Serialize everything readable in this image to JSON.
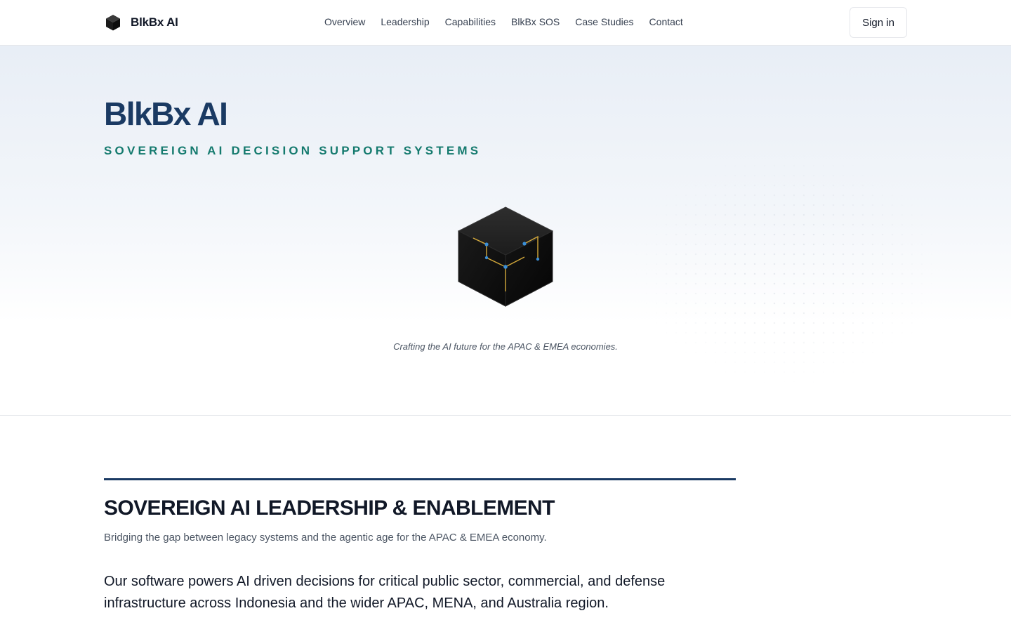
{
  "header": {
    "brand_name": "BlkBx AI",
    "nav": [
      {
        "label": "Overview"
      },
      {
        "label": "Leadership"
      },
      {
        "label": "Capabilities"
      },
      {
        "label": "BlkBx SOS"
      },
      {
        "label": "Case Studies"
      },
      {
        "label": "Contact"
      }
    ],
    "signin_label": "Sign in"
  },
  "hero": {
    "title": "BlkBx AI",
    "subtitle": "SOVEREIGN AI DECISION SUPPORT SYSTEMS",
    "cube_icon": "circuit-cube-icon",
    "tagline": "Crafting the AI future for the APAC & EMEA economies."
  },
  "section": {
    "heading": "SOVEREIGN AI LEADERSHIP & ENABLEMENT",
    "subheading": "Bridging the gap between legacy systems and the agentic age for the APAC & EMEA economy.",
    "body": "Our software powers AI driven decisions for critical public sector, commercial, and defense infrastructure across Indonesia and the wider APAC, MENA, and Australia region."
  },
  "colors": {
    "title_navy": "#1a3a63",
    "subtitle_teal": "#147a6e",
    "circuit_gold": "#d4a93a",
    "circuit_node_blue": "#3b8fd6"
  }
}
